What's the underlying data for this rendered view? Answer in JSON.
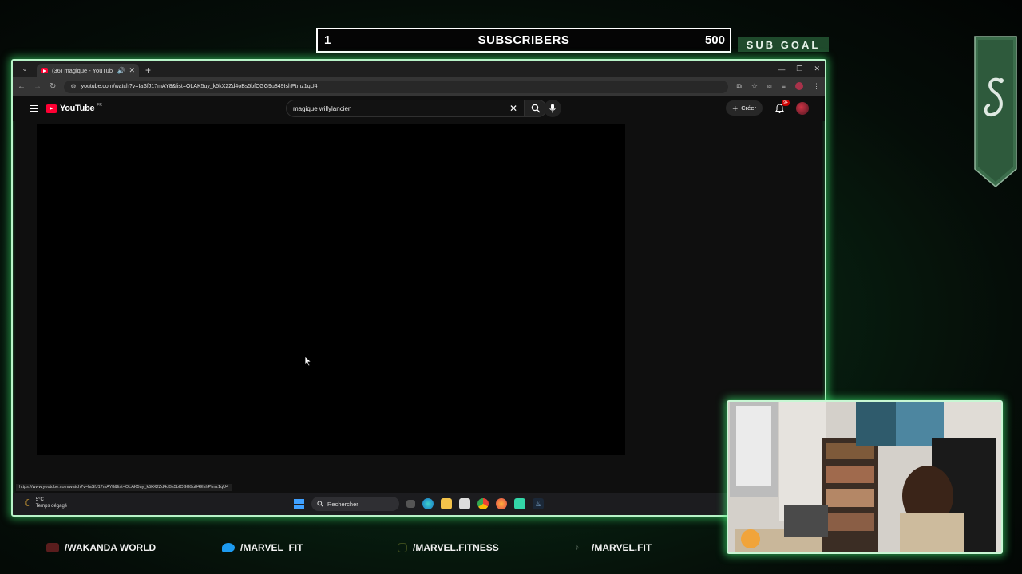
{
  "overlay": {
    "subgoal": {
      "current": "1",
      "label": "SUBSCRIBERS",
      "target": "500",
      "tag": "SUB GOAL"
    },
    "socials": [
      {
        "icon": "youtube-icon",
        "label": "/WAKANDA WORLD"
      },
      {
        "icon": "twitter-icon",
        "label": "/MARVEL_FIT"
      },
      {
        "icon": "instagram-icon",
        "label": "/MARVEL.FITNESS_"
      },
      {
        "icon": "tiktok-icon",
        "label": "/MARVEL.FIT"
      }
    ],
    "accent_color": "#5ef08a"
  },
  "browser": {
    "tab": {
      "title": "(36) magique - YouTube"
    },
    "url": "youtube.com/watch?v=IaSfJ17mAY8&list=OLAK5uy_k5kX2Zd4oBs5bfCGG9u849IshPtmz1qU4",
    "status_link": "https://www.youtube.com/watch?v=IaSfJ17mAY8&list=OLAK5uy_k5kX2Zd4oBs5bfCGG9u849IshPtmz1qU4"
  },
  "youtube": {
    "logo_text": "YouTube",
    "country": "FR",
    "search_value": "magique willylancien",
    "create_label": "Créer",
    "notifications_badge": "9+"
  },
  "taskbar": {
    "weather_temp": "5°C",
    "weather_desc": "Temps dégagé",
    "search_placeholder": "Rechercher"
  }
}
